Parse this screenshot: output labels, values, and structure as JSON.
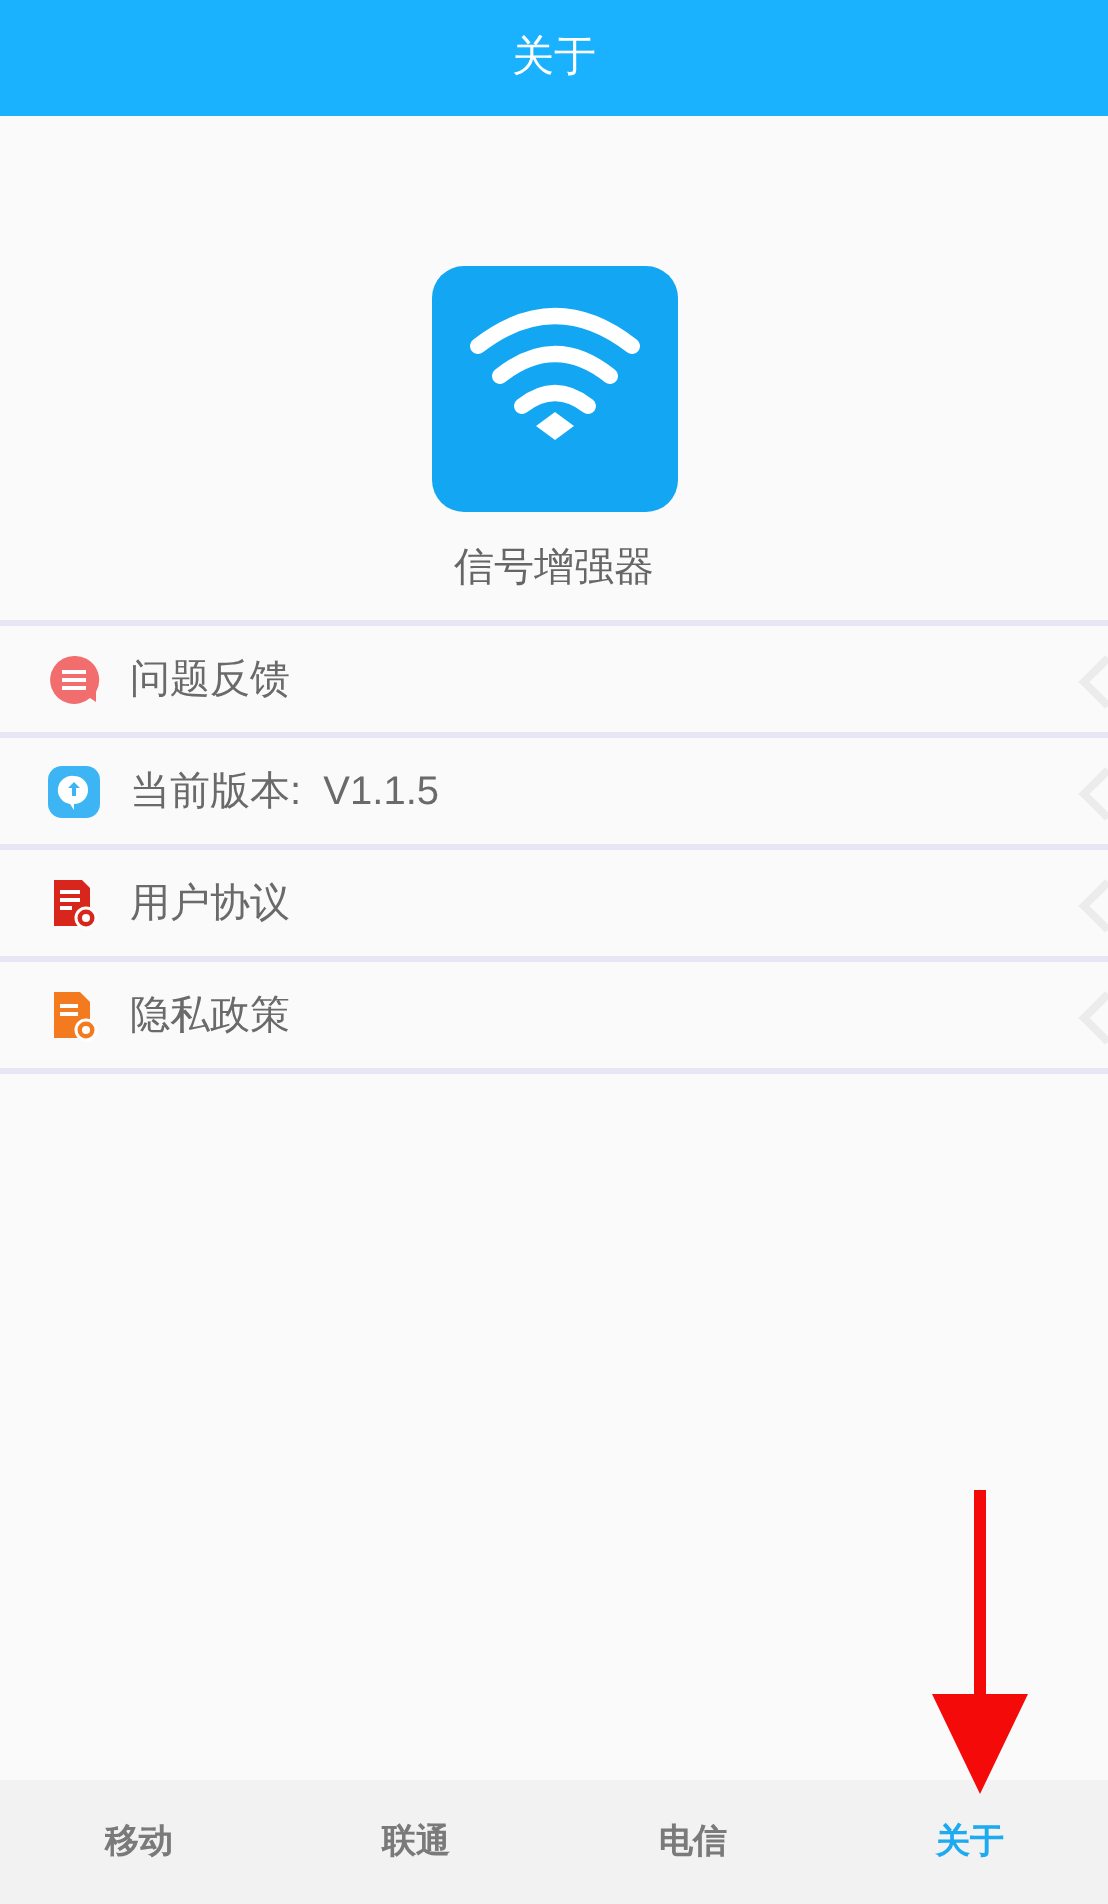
{
  "header": {
    "title": "关于"
  },
  "app": {
    "name": "信号增强器"
  },
  "menu": [
    {
      "kind": "feedback",
      "label": "问题反馈"
    },
    {
      "kind": "version",
      "label": "当前版本:  V1.1.5"
    },
    {
      "kind": "agreement",
      "label": "用户协议"
    },
    {
      "kind": "privacy",
      "label": "隐私政策"
    }
  ],
  "tabs": [
    {
      "label": "移动",
      "selected": false
    },
    {
      "label": "联通",
      "selected": false
    },
    {
      "label": "电信",
      "selected": false
    },
    {
      "label": "关于",
      "selected": true
    }
  ]
}
